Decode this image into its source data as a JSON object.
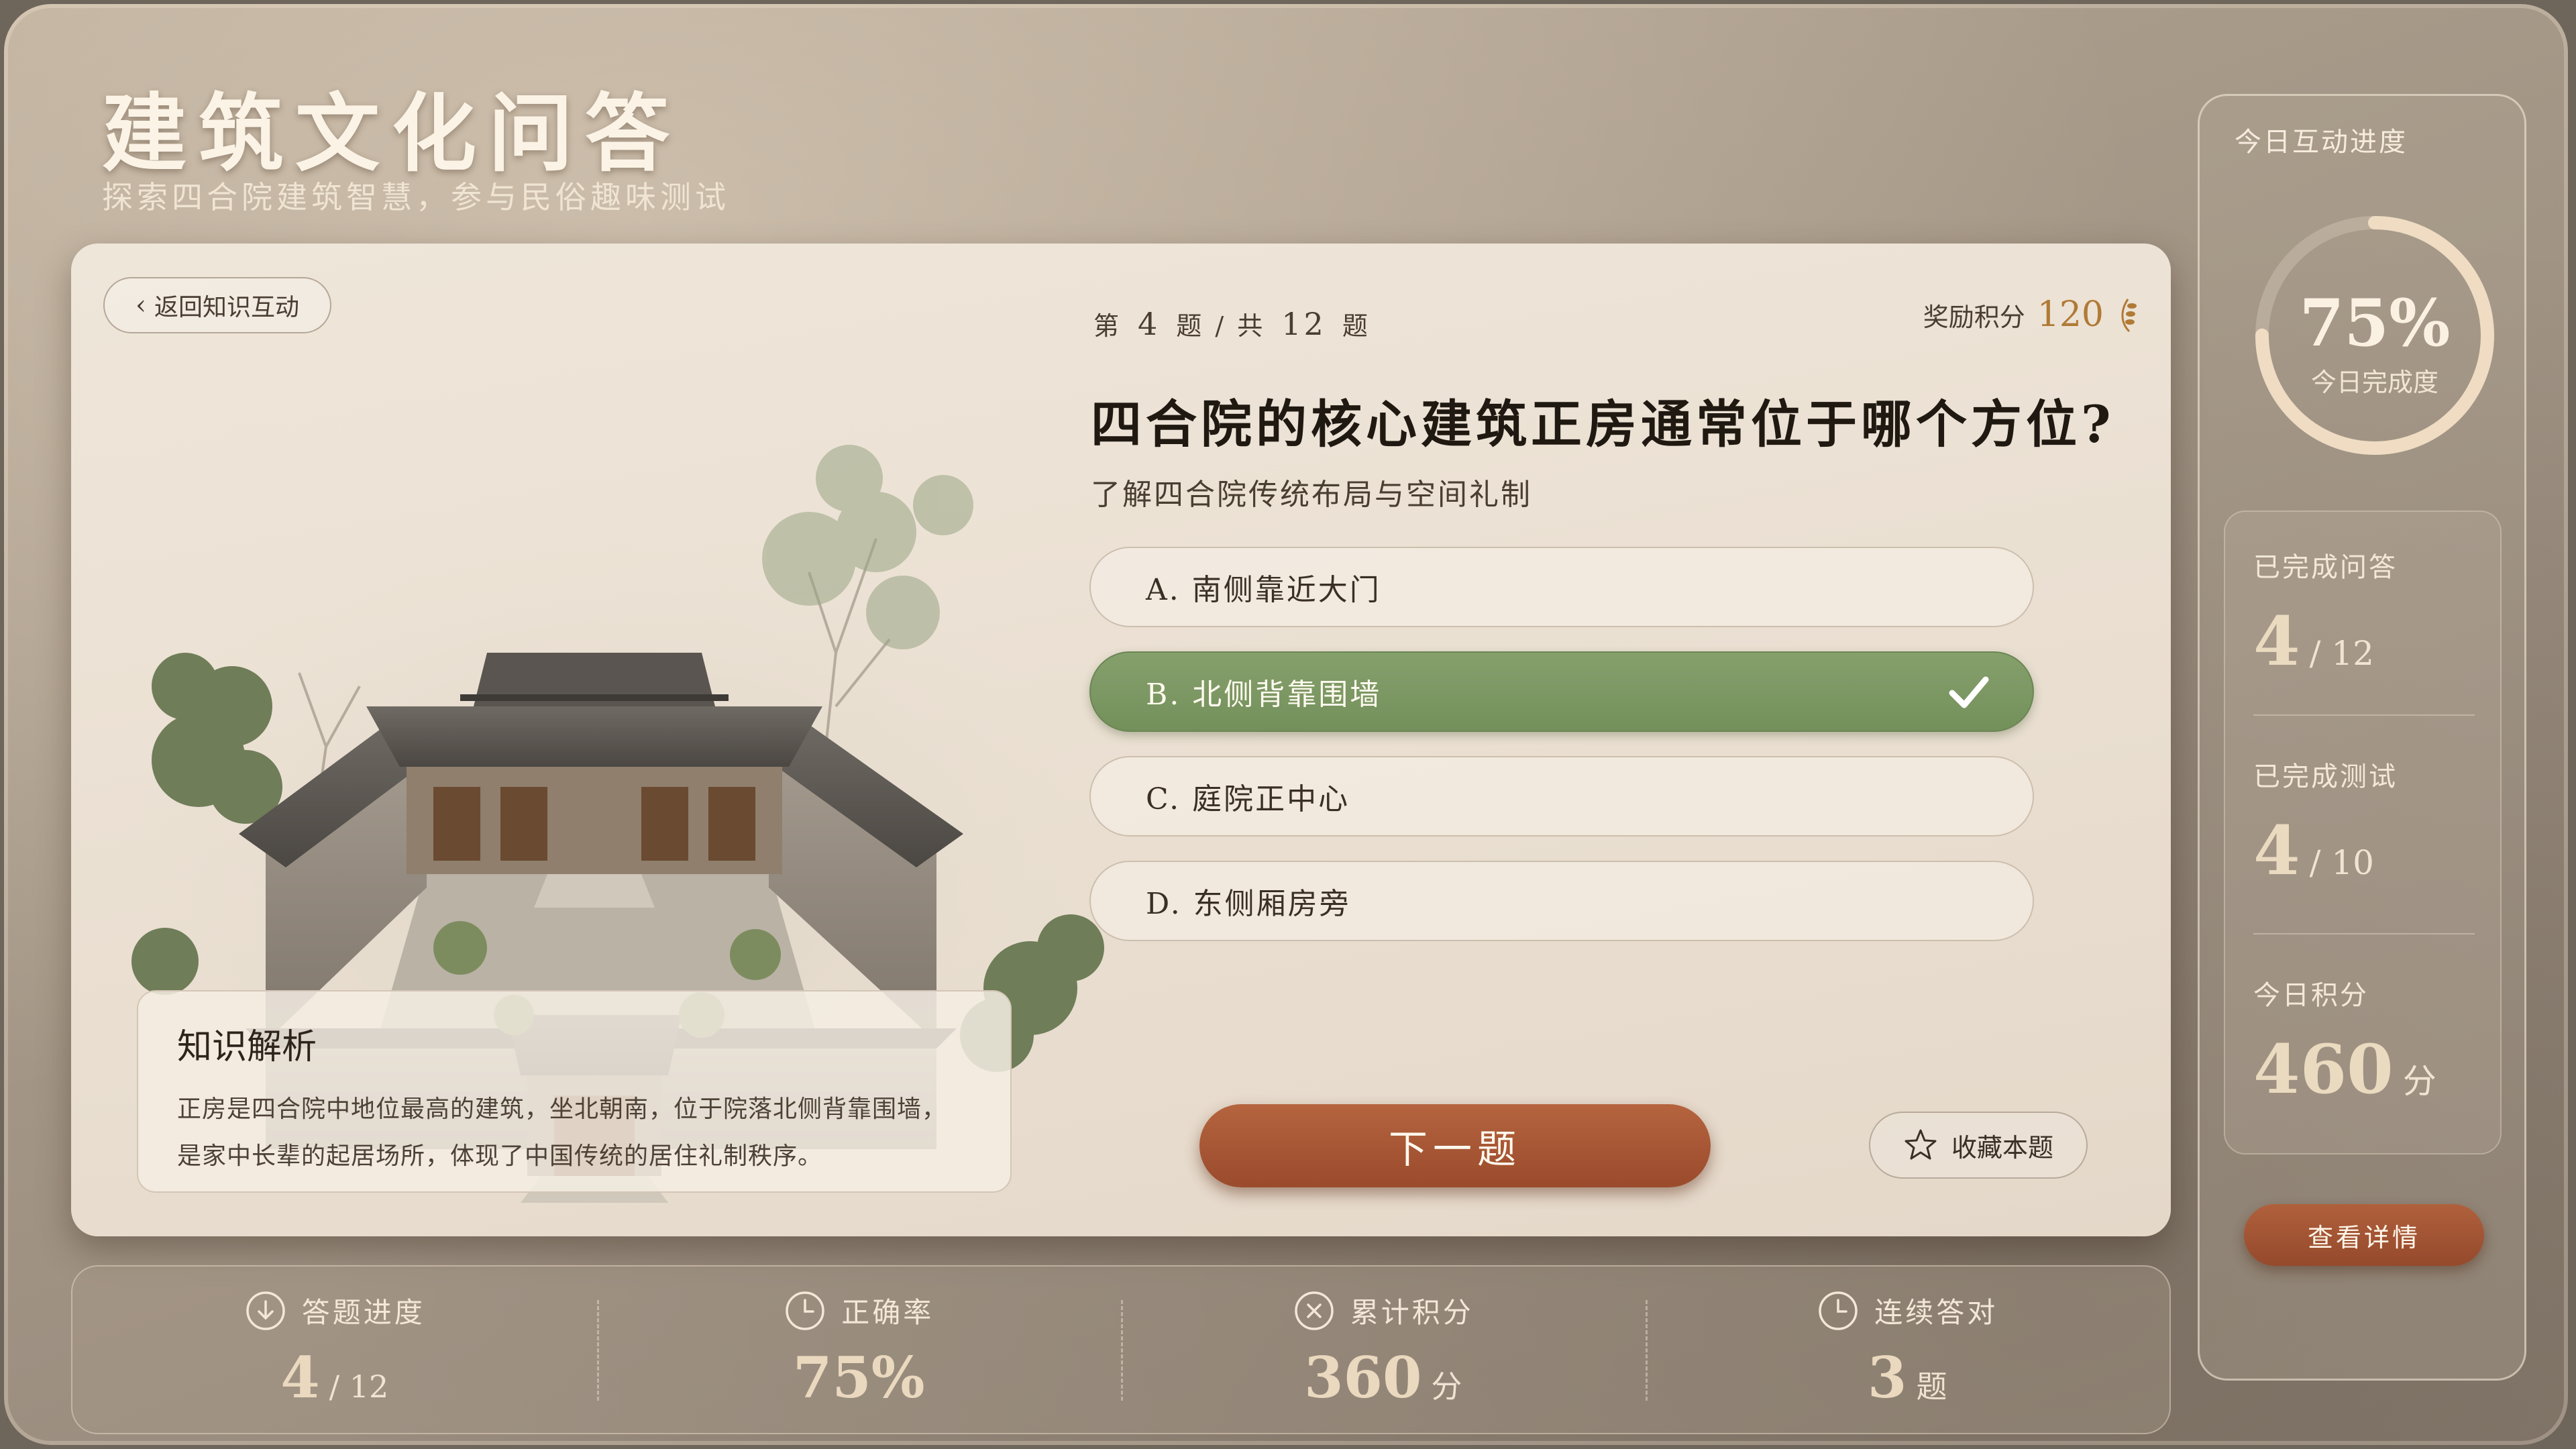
{
  "header": {
    "title": "建筑文化问答",
    "subtitle": "探索四合院建筑智慧，参与民俗趣味测试"
  },
  "quiz": {
    "back_label": "返回知识互动",
    "progress": {
      "prefix": "第",
      "current": "4",
      "mid": "题 / 共",
      "total": "12",
      "suffix": "题"
    },
    "reward_label": "奖励积分",
    "reward_points": "120",
    "question": "四合院的核心建筑正房通常位于哪个方位?",
    "question_sub": "了解四合院传统布局与空间礼制",
    "options": [
      {
        "label": "A. 南侧靠近大门",
        "state": "default"
      },
      {
        "label": "B. 北侧背靠围墙",
        "state": "correct"
      },
      {
        "label": "C. 庭院正中心",
        "state": "default"
      },
      {
        "label": "D. 东侧厢房旁",
        "state": "default"
      }
    ],
    "analysis": {
      "title": "知识解析",
      "text_line1": "正房是四合院中地位最高的建筑，坐北朝南，位于院落北侧背靠围墙，",
      "text_line2": "是家中长辈的起居场所，体现了中国传统的居住礼制秩序。"
    },
    "next_label": "下一题",
    "favorite_label": "收藏本题"
  },
  "stats": [
    {
      "label": "答题进度",
      "value": "4",
      "unit": "/ 12",
      "icon": "download-circle-icon"
    },
    {
      "label": "正确率",
      "value": "75%",
      "unit": "",
      "icon": "clock-icon"
    },
    {
      "label": "累计积分",
      "value": "360",
      "unit": "分",
      "icon": "x-circle-icon"
    },
    {
      "label": "连续答对",
      "value": "3",
      "unit": "题",
      "icon": "clock-icon"
    }
  ],
  "side": {
    "title": "今日互动进度",
    "ring_percent": "75%",
    "ring_fraction": 0.75,
    "ring_label": "今日完成度",
    "items": [
      {
        "label": "已完成问答",
        "value": "4",
        "sub": "/ 12"
      },
      {
        "label": "已完成测试",
        "value": "4",
        "sub": "/ 10"
      },
      {
        "label": "今日积分",
        "value": "460",
        "sub": "分"
      }
    ],
    "detail_label": "查看详情"
  },
  "colors": {
    "correct": "#7a9662",
    "primary_button": "#a85533",
    "gold": "#b07a36"
  }
}
